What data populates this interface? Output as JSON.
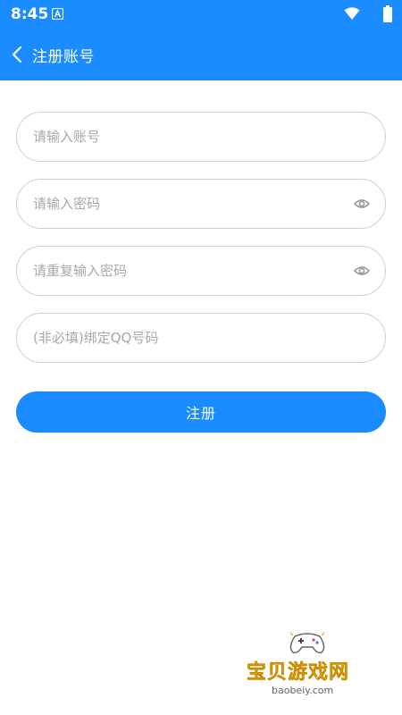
{
  "status_bar": {
    "time": "8:45",
    "icons": [
      "app-notification-icon",
      "wifi-icon",
      "battery-icon"
    ]
  },
  "header": {
    "back_icon": "chevron-left-icon",
    "title": "注册账号"
  },
  "form": {
    "account": {
      "placeholder": "请输入账号",
      "value": ""
    },
    "password": {
      "placeholder": "请输入密码",
      "value": "",
      "icon": "eye-icon"
    },
    "confirm_password": {
      "placeholder": "请重复输入密码",
      "value": "",
      "icon": "eye-icon"
    },
    "qq": {
      "placeholder": "(非必填)绑定QQ号码",
      "value": ""
    },
    "submit_label": "注册"
  },
  "watermark": {
    "title": "宝贝游戏网",
    "url": "baobeiy.com"
  },
  "colors": {
    "primary": "#1a8cff",
    "border": "#cfcfcf",
    "placeholder": "#a8a8a8",
    "watermark": "#f2b705"
  }
}
